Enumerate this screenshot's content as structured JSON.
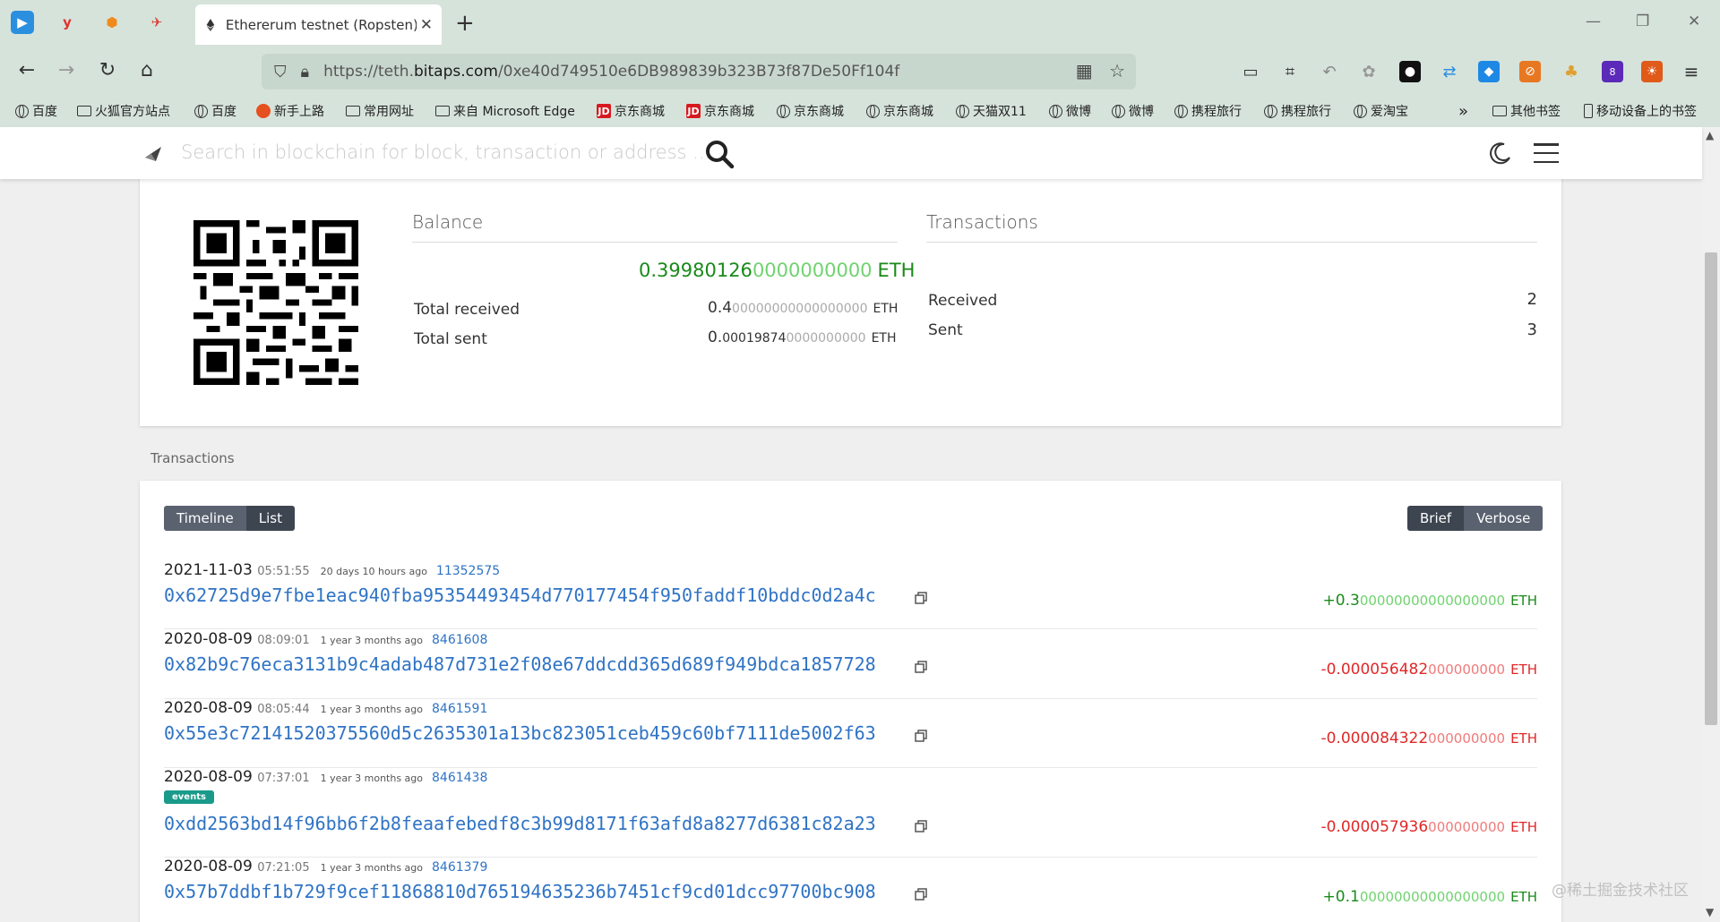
{
  "browser": {
    "tab_title": "Ethererum testnet (Ropsten) a",
    "url_prefix": "https://teth.",
    "url_domain": "bitaps.com",
    "url_path": "/0xe40d749510e6DB989839b323B73f87De50Ff104f",
    "bookmarks": [
      {
        "label": "百度",
        "icon": "globe-icon"
      },
      {
        "label": "火狐官方站点",
        "icon": "folder-icon"
      },
      {
        "label": "百度",
        "icon": "globe-icon"
      },
      {
        "label": "新手上路",
        "icon": "firefox-icon"
      },
      {
        "label": "常用网址",
        "icon": "folder-icon"
      },
      {
        "label": "来自 Microsoft Edge",
        "icon": "folder-icon"
      },
      {
        "label": "京东商城",
        "icon": "jd-icon"
      },
      {
        "label": "京东商城",
        "icon": "jd-icon"
      },
      {
        "label": "京东商城",
        "icon": "globe-icon"
      },
      {
        "label": "京东商城",
        "icon": "globe-icon"
      },
      {
        "label": "天猫双11",
        "icon": "globe-icon"
      },
      {
        "label": "微博",
        "icon": "globe-icon"
      },
      {
        "label": "微博",
        "icon": "globe-icon"
      },
      {
        "label": "携程旅行",
        "icon": "globe-icon"
      },
      {
        "label": "携程旅行",
        "icon": "globe-icon"
      },
      {
        "label": "爱淘宝",
        "icon": "globe-icon"
      }
    ],
    "other_bookmarks": "其他书签",
    "mobile_bookmarks": "移动设备上的书签",
    "extension_badge": "8",
    "accent_color": "#d6e3db"
  },
  "header": {
    "search_placeholder": "Search in blockchain for block, transaction or address ..."
  },
  "balance": {
    "title": "Balance",
    "main_bold": "0.39980126",
    "main_dim": "0000000000",
    "unit": "ETH",
    "total_received_label": "Total received",
    "total_received_bold": "0.4",
    "total_received_dim": "00000000000000000",
    "total_sent_label": "Total sent",
    "total_sent_bold": "0.",
    "total_sent_small": "00019874",
    "total_sent_dim": "0000000000"
  },
  "tx_summary": {
    "title": "Transactions",
    "received_label": "Received",
    "received_count": "2",
    "sent_label": "Sent",
    "sent_count": "3"
  },
  "transactions_section": {
    "label": "Transactions",
    "view_timeline": "Timeline",
    "view_list": "List",
    "mode_brief": "Brief",
    "mode_verbose": "Verbose"
  },
  "transactions": [
    {
      "date": "2021-11-03",
      "time": "05:51:55",
      "ago": "20 days 10 hours ago",
      "block": "11352575",
      "hash": "0x62725d9e7fbe1eac940fba95354493454d770177454f950faddf10bddc0d2a4c",
      "sign": "+",
      "amount_bold": "0.3",
      "amount_dim": "00000000000000000",
      "badge": ""
    },
    {
      "date": "2020-08-09",
      "time": "08:09:01",
      "ago": "1 year 3 months ago",
      "block": "8461608",
      "hash": "0x82b9c76eca3131b9c4adab487d731e2f08e67ddcdd365d689f949bdca1857728",
      "sign": "-",
      "amount_bold": "0.000056482",
      "amount_dim": "000000000",
      "badge": ""
    },
    {
      "date": "2020-08-09",
      "time": "08:05:44",
      "ago": "1 year 3 months ago",
      "block": "8461591",
      "hash": "0x55e3c72141520375560d5c2635301a13bc823051ceb459c60bf7111de5002f63",
      "sign": "-",
      "amount_bold": "0.000084322",
      "amount_dim": "000000000",
      "badge": ""
    },
    {
      "date": "2020-08-09",
      "time": "07:37:01",
      "ago": "1 year 3 months ago",
      "block": "8461438",
      "hash": "0xdd2563bd14f96bb6f2b8feaafebedf8c3b99d8171f63afd8a8277d6381c82a23",
      "sign": "-",
      "amount_bold": "0.000057936",
      "amount_dim": "000000000",
      "badge": "events"
    },
    {
      "date": "2020-08-09",
      "time": "07:21:05",
      "ago": "1 year 3 months ago",
      "block": "8461379",
      "hash": "0x57b7ddbf1b729f9cef11868810d765194635236b7451cf9cd01dcc97700bc908",
      "sign": "+",
      "amount_bold": "0.1",
      "amount_dim": "00000000000000000",
      "badge": ""
    }
  ],
  "watermark": "@稀土掘金技术社区"
}
